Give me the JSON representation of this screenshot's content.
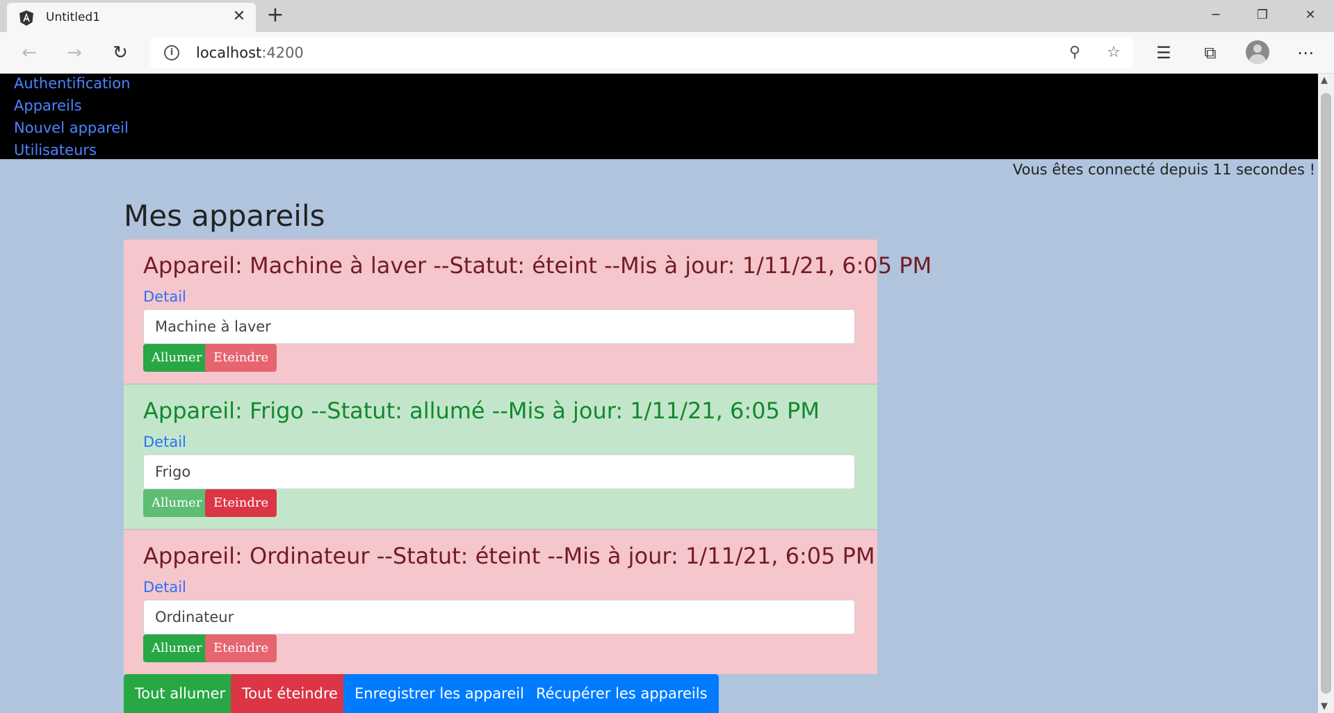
{
  "browser": {
    "tab_title": "Untitled1",
    "url_host": "localhost",
    "url_port": ":4200"
  },
  "nav": {
    "links": [
      "Authentification",
      "Appareils",
      "Nouvel appareil",
      "Utilisateurs"
    ]
  },
  "session_text": "Vous êtes connecté depuis 11 secondes !",
  "page_title": "Mes appareils",
  "appareils": [
    {
      "heading": "Appareil: Machine à laver --Statut: éteint --Mis à jour: 1/11/21, 6:05 PM",
      "detail": "Detail",
      "name": "Machine à laver",
      "status": "éteint",
      "btn_on": "Allumer",
      "btn_off": "Eteindre"
    },
    {
      "heading": "Appareil: Frigo --Statut: allumé --Mis à jour: 1/11/21, 6:05 PM",
      "detail": "Detail",
      "name": "Frigo",
      "status": "allumé",
      "btn_on": "Allumer",
      "btn_off": "Eteindre"
    },
    {
      "heading": "Appareil: Ordinateur --Statut: éteint --Mis à jour: 1/11/21, 6:05 PM",
      "detail": "Detail",
      "name": "Ordinateur",
      "status": "éteint",
      "btn_on": "Allumer",
      "btn_off": "Eteindre"
    }
  ],
  "actions": {
    "all_on": "Tout allumer",
    "all_off": "Tout éteindre",
    "save": "Enregistrer les appareils",
    "fetch": "Récupérer les appareils"
  },
  "colors": {
    "page_bg": "#b0c4de",
    "item_off_bg": "#f5c6cb",
    "item_on_bg": "#c3e6cb",
    "green": "#28a745",
    "red": "#dc3545",
    "blue": "#007bff"
  }
}
